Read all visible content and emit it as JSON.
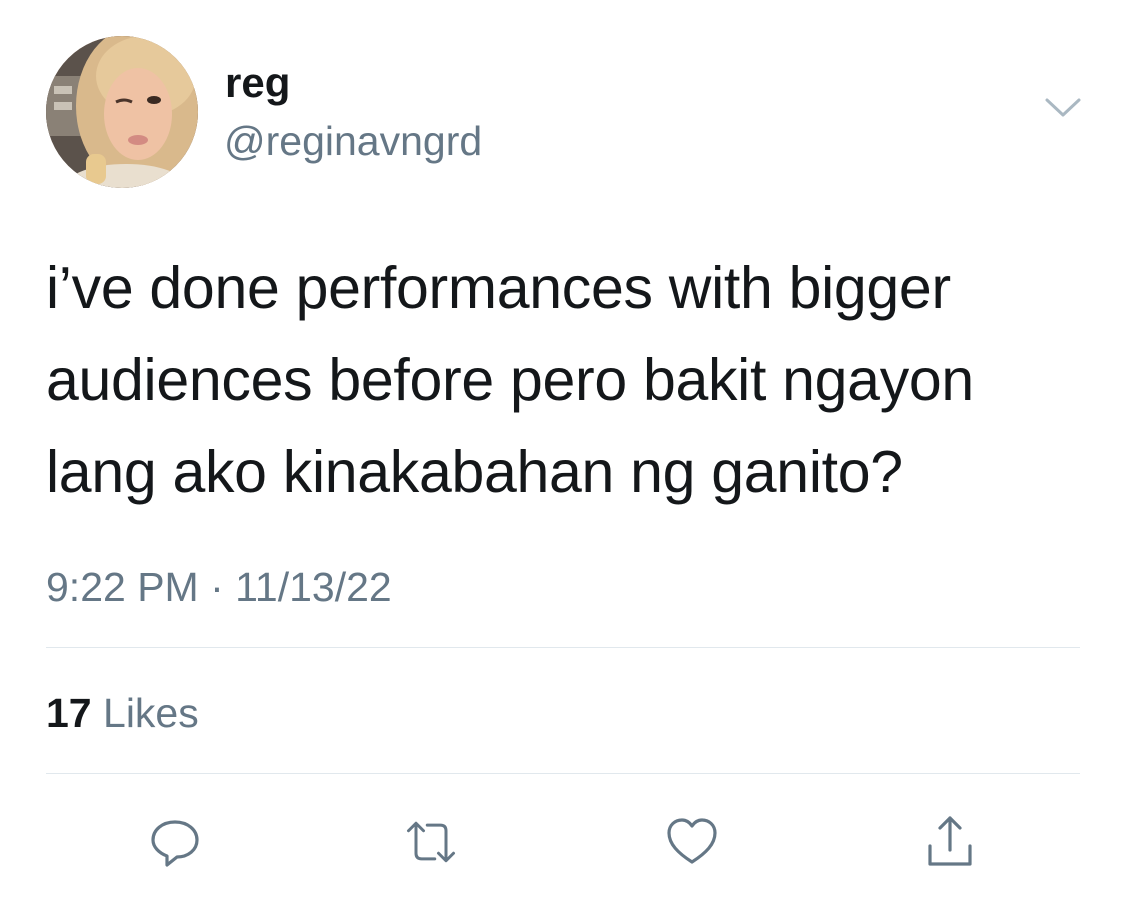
{
  "user": {
    "display_name": "reg",
    "handle": "@reginavngrd",
    "avatar_icon": "profile-photo"
  },
  "tweet": {
    "text": "i’ve done performances with bigger audiences before pero bakit ngayon lang ako kinakabahan ng ganito?",
    "time": "9:22 PM",
    "separator": "·",
    "date": "11/13/22"
  },
  "stats": {
    "likes_count": "17",
    "likes_label": "Likes"
  },
  "actions": {
    "reply_icon": "reply-icon",
    "retweet_icon": "retweet-icon",
    "like_icon": "heart-icon",
    "share_icon": "share-icon"
  },
  "colors": {
    "primary_text": "#14171a",
    "secondary_text": "#657786",
    "divider": "#e1e8ed"
  }
}
